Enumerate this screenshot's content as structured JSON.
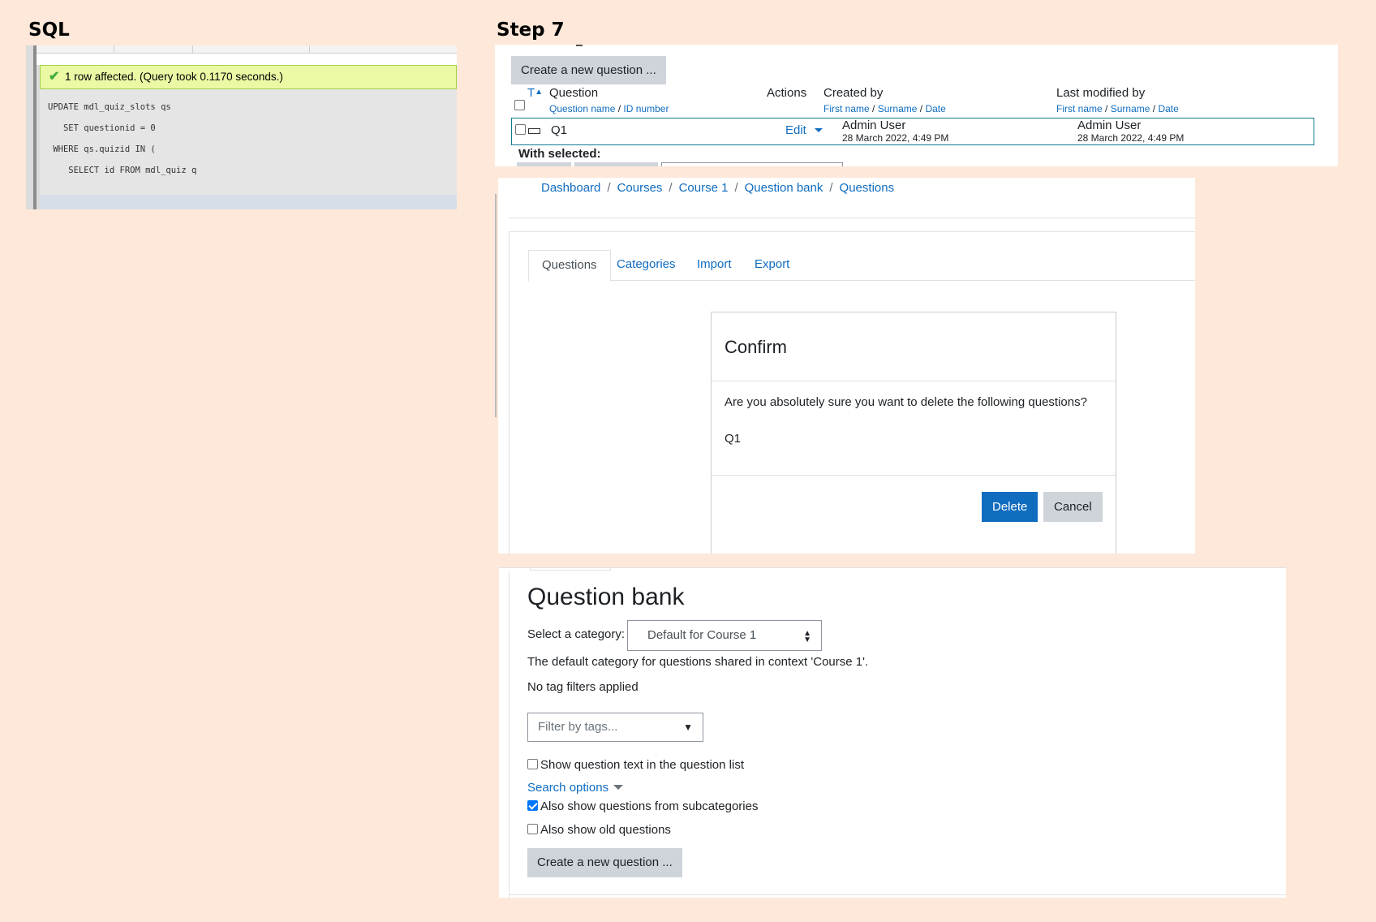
{
  "labels": {
    "sql_heading": "SQL",
    "step_heading": "Step 7"
  },
  "sql": {
    "success_message": "1 row affected. (Query took 0.1170 seconds.)",
    "code_lines": [
      "UPDATE mdl_quiz_slots qs",
      "   SET questionid = 0",
      " WHERE qs.quizid IN (",
      "    SELECT id FROM mdl_quiz q"
    ]
  },
  "question_table": {
    "create_button": "Create a new question ...",
    "headers": {
      "type": "T",
      "question": "Question",
      "question_sub_name": "Question name",
      "question_sub_id": "ID number",
      "actions": "Actions",
      "created_by": "Created by",
      "modified_by": "Last modified by",
      "sub_first": "First name",
      "sub_surname": "Surname",
      "sub_date": "Date",
      "slash": "/"
    },
    "row": {
      "name": "Q1",
      "action": "Edit",
      "created_user": "Admin User",
      "created_date": "28 March 2022, 4:49 PM",
      "modified_user": "Admin User",
      "modified_date": "28 March 2022, 4:49 PM"
    },
    "with_selected": "With selected:"
  },
  "breadcrumb": [
    "Dashboard",
    "Courses",
    "Course 1",
    "Question bank",
    "Questions"
  ],
  "breadcrumb_sep": "/",
  "tabs": [
    "Questions",
    "Categories",
    "Import",
    "Export"
  ],
  "confirm": {
    "title": "Confirm",
    "message": "Are you absolutely sure you want to delete the following questions?",
    "question": "Q1",
    "delete_label": "Delete",
    "cancel_label": "Cancel"
  },
  "question_bank": {
    "title": "Question bank",
    "category_label": "Select a category:",
    "category_value": "Default for Course 1",
    "category_description": "The default category for questions shared in context 'Course 1'.",
    "no_tags": "No tag filters applied",
    "filter_placeholder": "Filter by tags...",
    "show_text_label": "Show question text in the question list",
    "show_text_checked": false,
    "search_options": "Search options",
    "subcategories_label": "Also show questions from subcategories",
    "subcategories_checked": true,
    "old_questions_label": "Also show old questions",
    "old_questions_checked": false,
    "create_button": "Create a new question ..."
  },
  "colors": {
    "background": "#fde8d9",
    "link": "#0f6cbf",
    "primary_button": "#0f6cbf",
    "secondary_button": "#ced4da",
    "sql_success_bg": "#ebf8a4"
  }
}
